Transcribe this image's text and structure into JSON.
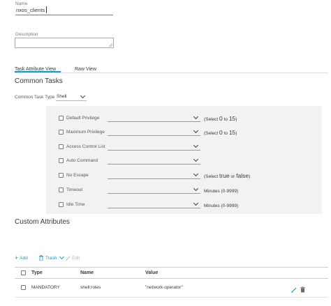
{
  "form": {
    "name_label": "Name",
    "name_value": "nxos_clients",
    "description_label": "Description",
    "description_value": ""
  },
  "tabs": [
    {
      "label": "Task Attribute View",
      "active": true
    },
    {
      "label": "Raw View",
      "active": false
    }
  ],
  "common_tasks": {
    "heading": "Common Tasks",
    "type_label": "Common Task Type",
    "type_value": "Shell",
    "rows": [
      {
        "label": "Default Privilege",
        "hint_pre": "(Select ",
        "hint_a": "0",
        "hint_mid": " to ",
        "hint_b": "15",
        "hint_post": ")"
      },
      {
        "label": "Maximum Privilege",
        "hint_pre": "(Select ",
        "hint_a": "0",
        "hint_mid": " to ",
        "hint_b": "15",
        "hint_post": ")"
      },
      {
        "label": "Access Control List",
        "hint_pre": "",
        "hint_a": "",
        "hint_mid": "",
        "hint_b": "",
        "hint_post": ""
      },
      {
        "label": "Auto Command",
        "hint_pre": "",
        "hint_a": "",
        "hint_mid": "",
        "hint_b": "",
        "hint_post": ""
      },
      {
        "label": "No Escape",
        "hint_pre": "(Select ",
        "hint_a": "true",
        "hint_mid": " or ",
        "hint_b": "false",
        "hint_post": ")"
      },
      {
        "label": "Timeout",
        "hint_pre": "Minutes (0-9999)",
        "hint_a": "",
        "hint_mid": "",
        "hint_b": "",
        "hint_post": ""
      },
      {
        "label": "Idle Time",
        "hint_pre": "Minutes (0-9999)",
        "hint_a": "",
        "hint_mid": "",
        "hint_b": "",
        "hint_post": ""
      }
    ]
  },
  "custom_attributes": {
    "heading": "Custom Attributes",
    "toolbar": {
      "add": "Add",
      "trash": "Trash",
      "edit": "Edit"
    },
    "columns": [
      "Type",
      "Name",
      "Value"
    ],
    "rows": [
      {
        "type": "MANDATORY",
        "name": "shell:roles",
        "value": "\"network-operator\""
      }
    ]
  },
  "colors": {
    "accent": "#049fd9",
    "panel": "#f2f2f2",
    "text": "#39393b"
  },
  "icons": [
    "plus-icon",
    "trash-icon",
    "chevron-down-icon",
    "pencil-icon",
    "checkbox-icon"
  ]
}
